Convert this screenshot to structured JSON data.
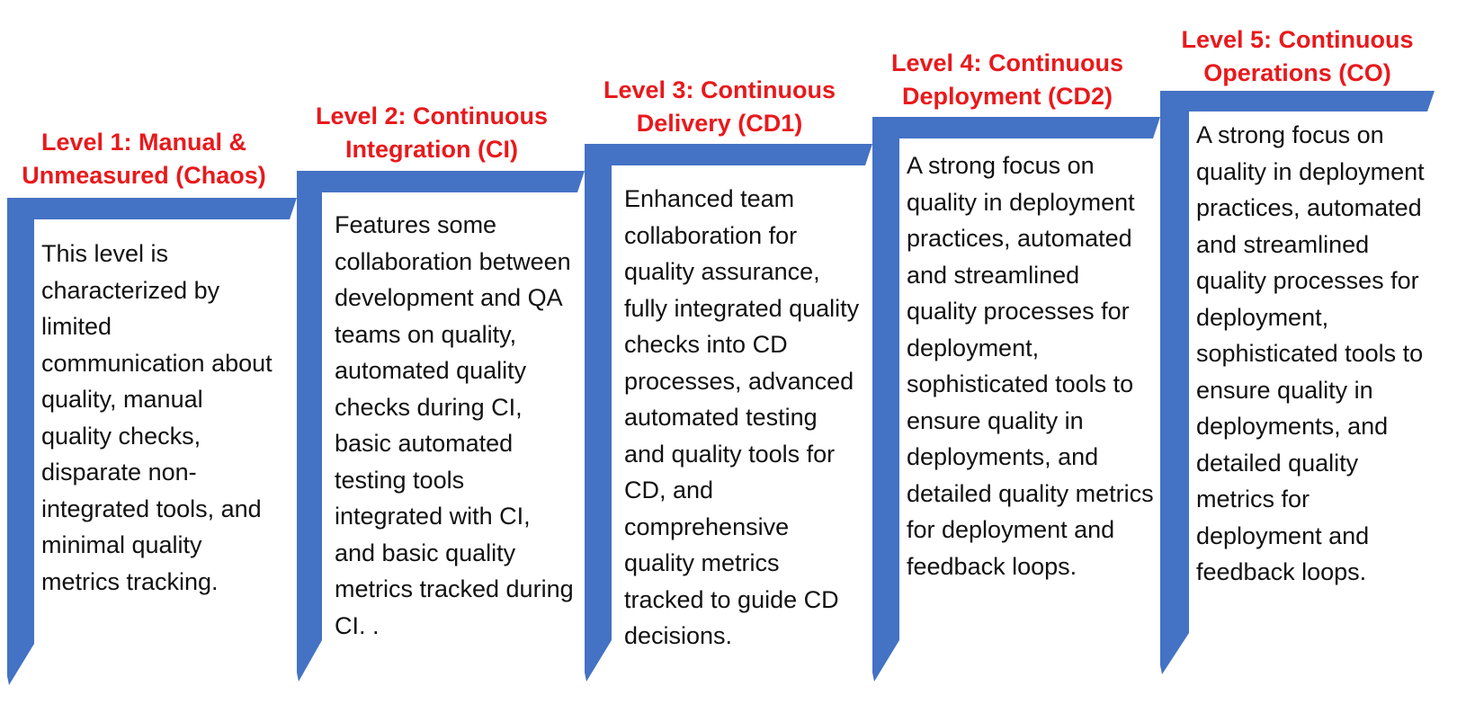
{
  "colors": {
    "step_blue": "#4472c4",
    "title_red": "#e8191c",
    "text": "#111111"
  },
  "levels": [
    {
      "title": "Level 1: Manual &\nUnmeasured (Chaos)",
      "description": "This level is characterized by limited communication about quality, manual quality checks, disparate non-integrated tools, and minimal quality metrics tracking."
    },
    {
      "title": "Level 2: Continuous\nIntegration (CI)",
      "description": "Features some collaboration between development and QA teams on quality, automated quality checks during CI, basic automated testing tools integrated with CI, and basic quality metrics tracked during CI. ."
    },
    {
      "title": "Level 3: Continuous\nDelivery (CD1)",
      "description": "Enhanced team collaboration for quality assurance, fully integrated quality checks into CD processes, advanced automated testing and quality tools for CD, and comprehensive quality metrics tracked to guide CD decisions."
    },
    {
      "title": "Level 4: Continuous\nDeployment (CD2)",
      "description": "A strong focus on quality in deployment practices, automated and streamlined quality processes for deployment, sophisticated tools to ensure quality in deployments, and detailed quality metrics for deployment and feedback loops."
    },
    {
      "title": "Level 5: Continuous\nOperations (CO)",
      "description": "A strong focus on quality in deployment practices, automated and streamlined quality processes for deployment, sophisticated tools to ensure quality in deployments, and detailed quality metrics for deployment and feedback loops."
    }
  ]
}
